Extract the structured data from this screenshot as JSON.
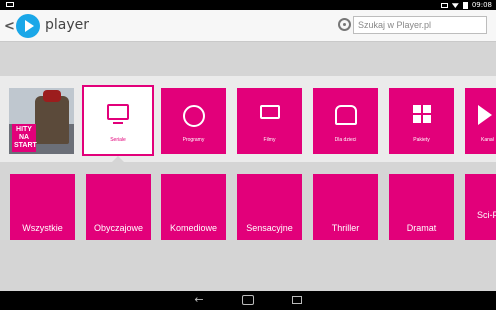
{
  "status": {
    "time": "09:08"
  },
  "app": {
    "title": "player",
    "back": "<"
  },
  "search": {
    "placeholder": "Szukaj w Player.pl"
  },
  "promo": {
    "label": "HITY NA START"
  },
  "categories": [
    {
      "label": "Seriale",
      "icon": "tv-icon"
    },
    {
      "label": "Programy",
      "icon": "film-reel-icon"
    },
    {
      "label": "Filmy",
      "icon": "movie-camera-icon"
    },
    {
      "label": "Dla dzieci",
      "icon": "kids-icon"
    },
    {
      "label": "Pakiety",
      "icon": "grid-icon"
    },
    {
      "label": "Kanał",
      "icon": "play-icon"
    }
  ],
  "genres": [
    "Wszystkie",
    "Obyczajowe",
    "Komediowe",
    "Sensacyjne",
    "Thriller",
    "Dramat",
    "Sci-Fant"
  ],
  "colors": {
    "accent": "#e2007a",
    "brand": "#1aa7e8"
  }
}
